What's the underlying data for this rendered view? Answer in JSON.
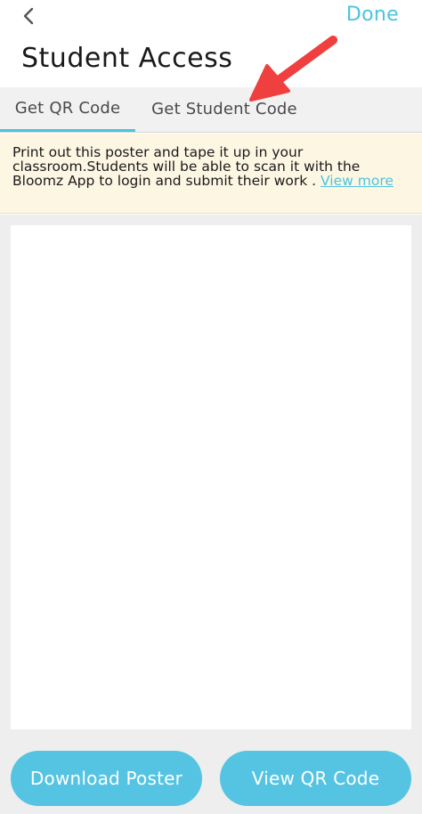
{
  "header": {
    "done_label": "Done",
    "title": "Student Access",
    "back_icon": "chevron-left-icon"
  },
  "tabs": [
    {
      "label": "Get QR Code",
      "active": true
    },
    {
      "label": "Get Student Code",
      "active": false
    }
  ],
  "info": {
    "text": "Print out this poster and tape it up in your classroom.Students will be able to scan it with the Bloomz App to login and submit their work . ",
    "link_label": "View more"
  },
  "actions": {
    "download_label": "Download Poster",
    "view_label": "View QR Code"
  },
  "colors": {
    "accent": "#4ec3de",
    "button": "#55c4e2",
    "annotation_arrow": "#ef3f3f",
    "banner_bg": "#fdf6e3"
  }
}
